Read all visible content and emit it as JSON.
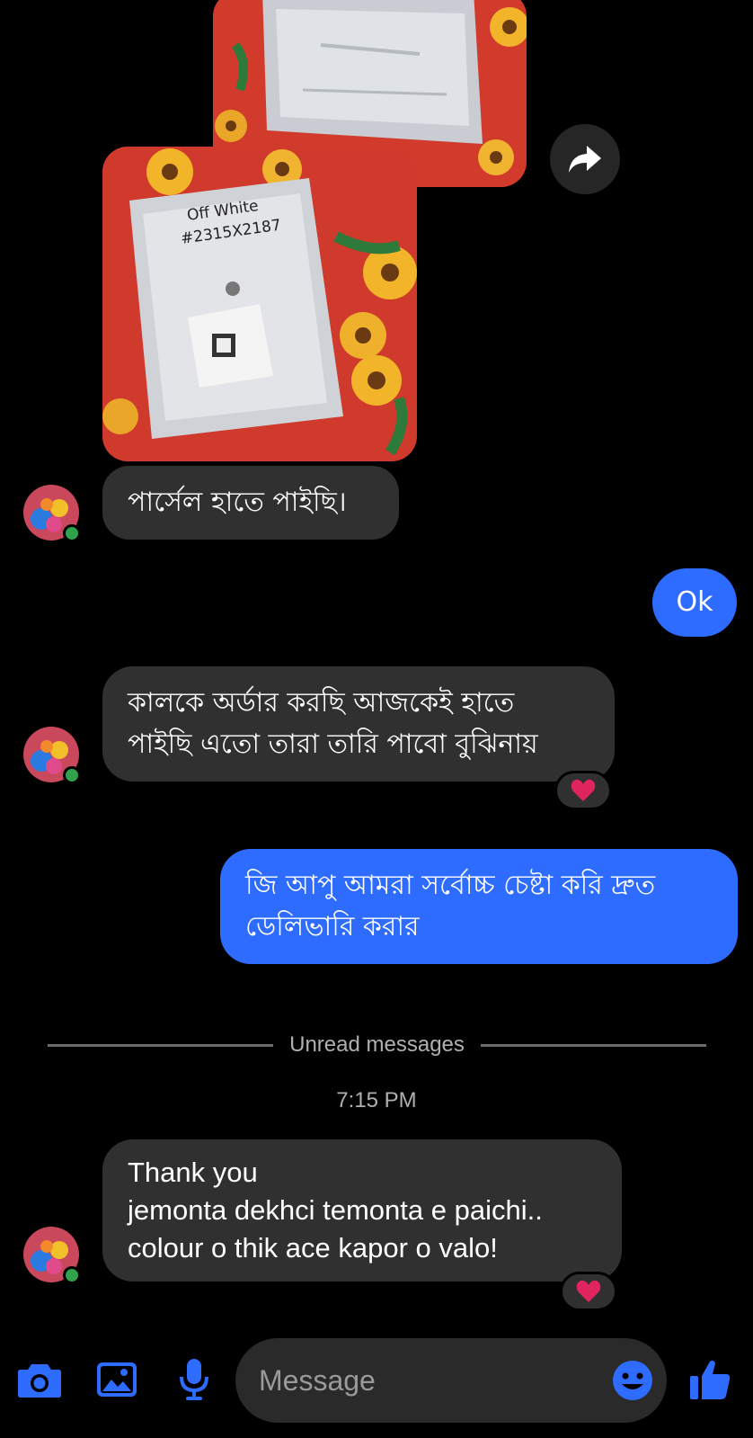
{
  "thread": {
    "messages": [
      {
        "id": "photo-1",
        "type": "image",
        "from": "them",
        "label": ""
      },
      {
        "id": "photo-2",
        "type": "image",
        "from": "them",
        "handwritten_text": "Off White #2315X2187"
      },
      {
        "id": "m1",
        "from": "them",
        "text": "পার্সেল হাতে পাইছি।"
      },
      {
        "id": "m2",
        "from": "me",
        "text": "Ok"
      },
      {
        "id": "m3",
        "from": "them",
        "lines": [
          "কালকে অর্ডার করছি আজকেই হাতে",
          "পাইছি এতো তারা তারি পাবো বুঝিনায়"
        ],
        "reaction": "heart"
      },
      {
        "id": "m4",
        "from": "me",
        "lines": [
          "জি আপু আমরা সর্বোচ্চ চেষ্টা করি দ্রুত",
          "ডেলিভারি করার"
        ]
      },
      {
        "id": "m5",
        "from": "them",
        "lines": [
          "Thank you",
          "jemonta dekhci temonta e paichi..",
          "colour o thik ace kapor o valo!"
        ],
        "reaction": "heart"
      }
    ],
    "unread_label": "Unread messages",
    "timestamp": "7:15 PM"
  },
  "composer": {
    "placeholder": "Message",
    "icons": [
      "camera-icon",
      "gallery-icon",
      "microphone-icon",
      "emoji-icon",
      "thumbs-up-icon"
    ]
  },
  "colors": {
    "background": "#000000",
    "incoming_bubble": "#303030",
    "outgoing_bubble": "#2e6bff",
    "accent": "#2e6bff",
    "online": "#31a24c",
    "reaction_heart": "#e0245e"
  }
}
